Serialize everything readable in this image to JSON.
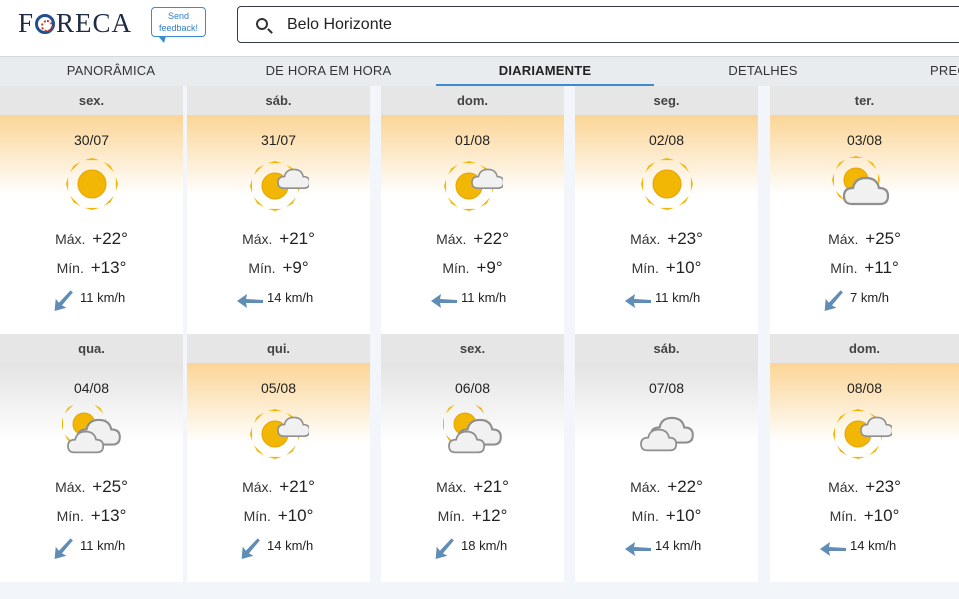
{
  "header": {
    "logo": "FORECA",
    "feedback_line1": "Send",
    "feedback_line2": "feedback!",
    "search_value": "Belo Horizonte"
  },
  "tabs": [
    {
      "label": "PANORÂMICA"
    },
    {
      "label": "DE HORA EM HORA"
    },
    {
      "label": "DIARIAMENTE",
      "active": true
    },
    {
      "label": "DETALHES"
    },
    {
      "label": "PREC"
    }
  ],
  "labels": {
    "max": "Máx.",
    "min": "Mín."
  },
  "days": [
    {
      "dname": "sex.",
      "date": "30/07",
      "max": "+22°",
      "min": "+13°",
      "wind": "11 km/h",
      "icon": "sun-icon",
      "wind_dir": "from-southeast",
      "band": "warm"
    },
    {
      "dname": "sáb.",
      "date": "31/07",
      "max": "+21°",
      "min": "+9°",
      "wind": "14 km/h",
      "icon": "sun-small-cloud-icon",
      "wind_dir": "from-east",
      "band": "warm"
    },
    {
      "dname": "dom.",
      "date": "01/08",
      "max": "+22°",
      "min": "+9°",
      "wind": "11 km/h",
      "icon": "sun-small-cloud-icon",
      "wind_dir": "from-east",
      "band": "warm"
    },
    {
      "dname": "seg.",
      "date": "02/08",
      "max": "+23°",
      "min": "+10°",
      "wind": "11 km/h",
      "icon": "sun-icon",
      "wind_dir": "from-east",
      "band": "warm"
    },
    {
      "dname": "ter.",
      "date": "03/08",
      "max": "+25°",
      "min": "+11°",
      "wind": "7 km/h",
      "icon": "partly-cloudy-icon",
      "wind_dir": "from-southeast",
      "band": "warm"
    },
    {
      "dname": "qua.",
      "date": "04/08",
      "max": "+25°",
      "min": "+13°",
      "wind": "11 km/h",
      "icon": "mostly-cloudy-icon",
      "wind_dir": "from-southeast",
      "band": "cool"
    },
    {
      "dname": "qui.",
      "date": "05/08",
      "max": "+21°",
      "min": "+10°",
      "wind": "14 km/h",
      "icon": "sun-small-cloud-icon",
      "wind_dir": "from-southeast",
      "band": "warm"
    },
    {
      "dname": "sex.",
      "date": "06/08",
      "max": "+21°",
      "min": "+12°",
      "wind": "18 km/h",
      "icon": "mostly-cloudy-icon",
      "wind_dir": "from-southeast",
      "band": "cool"
    },
    {
      "dname": "sáb.",
      "date": "07/08",
      "max": "+22°",
      "min": "+10°",
      "wind": "14 km/h",
      "icon": "cloudy-icon",
      "wind_dir": "from-east",
      "band": "cool"
    },
    {
      "dname": "dom.",
      "date": "08/08",
      "max": "+23°",
      "min": "+10°",
      "wind": "14 km/h",
      "icon": "sun-small-cloud-icon",
      "wind_dir": "from-east",
      "band": "warm"
    }
  ],
  "colors": {
    "accent": "#3b8bd0",
    "sun": "#f2b705",
    "cloud": "#9a9a9a",
    "arrow": "#5f8db5"
  }
}
